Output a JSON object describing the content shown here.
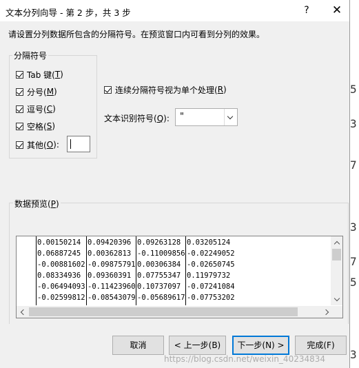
{
  "dialog": {
    "title": "文本分列向导 - 第 2 步，共 3 步",
    "help_icon": "?",
    "close_icon": "✕",
    "instruction": "请设置分列数据所包含的分隔符号。在预览窗口内可看到分列的效果。"
  },
  "delimiters": {
    "group_label": "分隔符号",
    "items": [
      {
        "label": "Tab 键(",
        "mnemonic": "T",
        "suffix": ")",
        "checked": true
      },
      {
        "label": "分号(",
        "mnemonic": "M",
        "suffix": ")",
        "checked": true
      },
      {
        "label": "逗号(",
        "mnemonic": "C",
        "suffix": ")",
        "checked": true
      },
      {
        "label": "空格(",
        "mnemonic": "S",
        "suffix": ")",
        "checked": true
      },
      {
        "label": "其他(",
        "mnemonic": "O",
        "suffix": "):",
        "checked": true
      }
    ],
    "other_value": ""
  },
  "consecutive": {
    "label": "连续分隔符号视为单个处理(",
    "mnemonic": "R",
    "suffix": ")",
    "checked": true
  },
  "qualifier": {
    "label": "文本识别符号(",
    "mnemonic": "Q",
    "suffix": "):",
    "value": "\""
  },
  "preview": {
    "label": "数据预览(",
    "mnemonic": "P",
    "suffix": ")",
    "rows": [
      [
        "0.00150214",
        "0.09420396",
        "0.09263128",
        "0.03205124"
      ],
      [
        "0.06887245",
        "0.00362813",
        "-0.11009856",
        "-0.02249052"
      ],
      [
        "-0.00881602",
        "-0.09875791",
        "0.00306384",
        "-0.02650745"
      ],
      [
        "0.08334936",
        "0.09360391",
        "0.07755347",
        "0.11979732"
      ],
      [
        "-0.06494093",
        "-0.11423960",
        "0.10737097",
        "-0.07241084"
      ],
      [
        "-0.02599812",
        "-0.08543079",
        "-0.05689617",
        "-0.07753202"
      ]
    ]
  },
  "buttons": {
    "cancel": "取消",
    "back": "< 上一步(B)",
    "next": "下一步(N) >",
    "finish": "完成(F)"
  },
  "watermark": "https://blog.csdn.net/weixin_40234834",
  "background_sheet_glyphs": [
    "5",
    "3",
    "7",
    "3",
    "7",
    "5",
    "3"
  ],
  "colors": {
    "dialog_bg": "#f0f0f0",
    "accent": "#0078d7",
    "frame": "#d6d6d6"
  }
}
